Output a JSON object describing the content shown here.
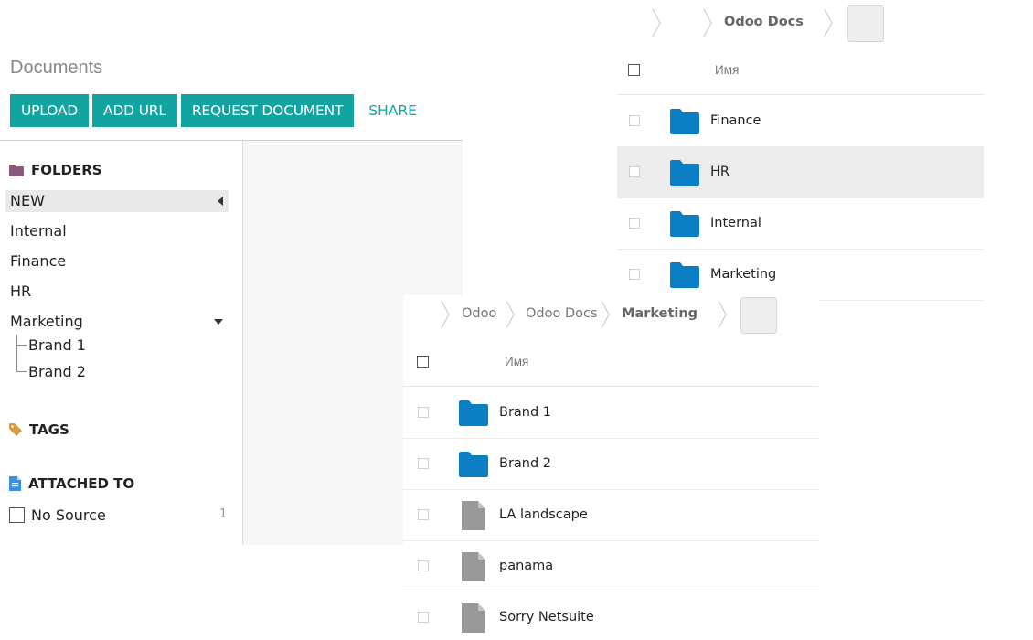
{
  "left": {
    "title": "Documents",
    "buttons": {
      "upload": "UPLOAD",
      "add_url": "ADD URL",
      "request": "REQUEST DOCUMENT",
      "share": "SHARE"
    },
    "folders_head": "FOLDERS",
    "folders": [
      "NEW",
      "Internal",
      "Finance",
      "HR",
      "Marketing"
    ],
    "subfolders": [
      "Brand 1",
      "Brand 2"
    ],
    "tags_head": "TAGS",
    "attached_head": "ATTACHED TO",
    "no_source": "No Source",
    "no_source_count": "1"
  },
  "list1": {
    "breadcrumb": [
      "Odoo Docs"
    ],
    "column": "Имя",
    "rows": [
      "Finance",
      "HR",
      "Internal",
      "Marketing"
    ]
  },
  "list2": {
    "breadcrumb": [
      "Odoo",
      "Odoo Docs",
      "Marketing"
    ],
    "column": "Имя",
    "rows": [
      "Brand 1",
      "Brand 2",
      "LA landscape",
      "panama",
      "Sorry Netsuite"
    ]
  },
  "icons": {
    "folder": "folder-icon",
    "file": "file-icon",
    "tag": "tag-icon",
    "document": "document-icon"
  },
  "colors": {
    "accent": "#13a3a0",
    "folder_blue": "#0b7fc4",
    "file_gray": "#999999",
    "folder_purple": "#875a7b",
    "tag_orange": "#d99b3f",
    "doc_blue": "#3e8ee6"
  }
}
